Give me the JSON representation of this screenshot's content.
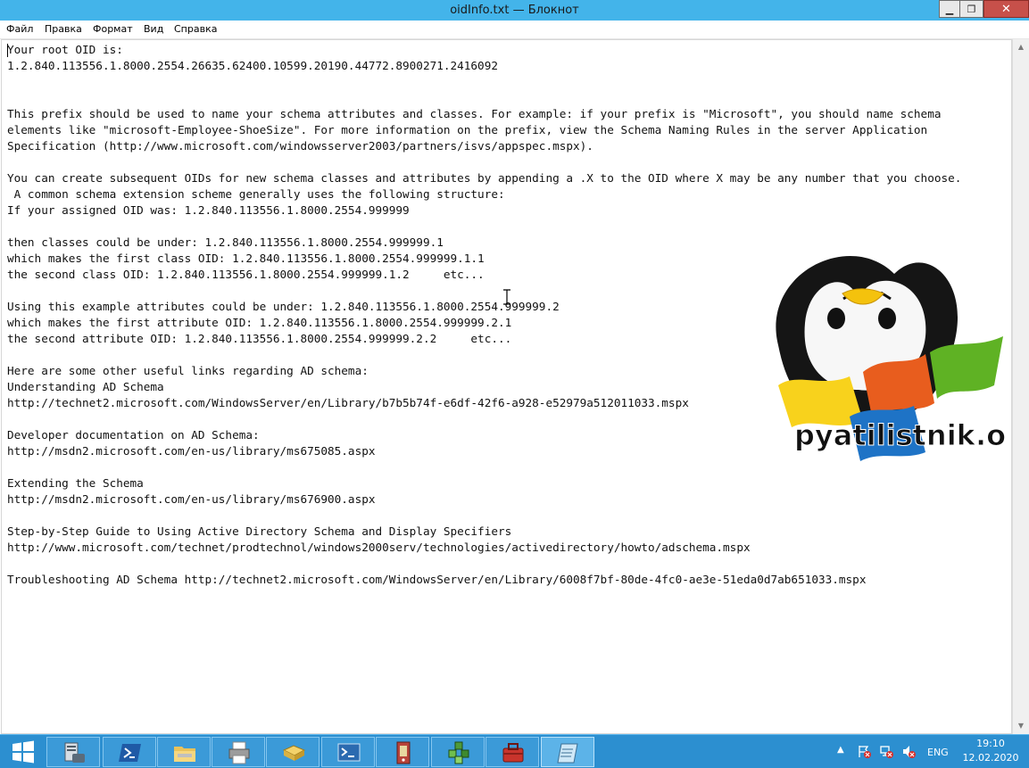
{
  "window": {
    "title": "oidInfo.txt — Блокнот",
    "minimize_glyph": "▁",
    "maximize_glyph": "❐",
    "close_glyph": "✕"
  },
  "menu": {
    "items": [
      "Файл",
      "Правка",
      "Формат",
      "Вид",
      "Справка"
    ]
  },
  "document": {
    "lines": [
      "Your root OID is:",
      "1.2.840.113556.1.8000.2554.26635.62400.10599.20190.44772.8900271.2416092",
      "",
      "",
      "This prefix should be used to name your schema attributes and classes. For example: if your prefix is \"Microsoft\", you should name schema",
      "elements like \"microsoft-Employee-ShoeSize\". For more information on the prefix, view the Schema Naming Rules in the server Application",
      "Specification (http://www.microsoft.com/windowsserver2003/partners/isvs/appspec.mspx).",
      "",
      "You can create subsequent OIDs for new schema classes and attributes by appending a .X to the OID where X may be any number that you choose.",
      " A common schema extension scheme generally uses the following structure:",
      "If your assigned OID was: 1.2.840.113556.1.8000.2554.999999",
      "",
      "then classes could be under: 1.2.840.113556.1.8000.2554.999999.1",
      "which makes the first class OID: 1.2.840.113556.1.8000.2554.999999.1.1",
      "the second class OID: 1.2.840.113556.1.8000.2554.999999.1.2     etc...",
      "",
      "Using this example attributes could be under: 1.2.840.113556.1.8000.2554.999999.2",
      "which makes the first attribute OID: 1.2.840.113556.1.8000.2554.999999.2.1",
      "the second attribute OID: 1.2.840.113556.1.8000.2554.999999.2.2     etc...",
      "",
      "Here are some other useful links regarding AD schema:",
      "Understanding AD Schema",
      "http://technet2.microsoft.com/WindowsServer/en/Library/b7b5b74f-e6df-42f6-a928-e52979a512011033.mspx",
      "",
      "Developer documentation on AD Schema:",
      "http://msdn2.microsoft.com/en-us/library/ms675085.aspx",
      "",
      "Extending the Schema",
      "http://msdn2.microsoft.com/en-us/library/ms676900.aspx",
      "",
      "Step-by-Step Guide to Using Active Directory Schema and Display Specifiers",
      "http://www.microsoft.com/technet/prodtechnol/windows2000serv/technologies/activedirectory/howto/adschema.mspx",
      "",
      "Troubleshooting AD Schema http://technet2.microsoft.com/WindowsServer/en/Library/6008f7bf-80de-4fc0-ae3e-51eda0d7ab651033.mspx"
    ]
  },
  "watermark": {
    "text": "pyatilistnik.org"
  },
  "scrollbar": {
    "up_glyph": "▲",
    "down_glyph": "▼"
  },
  "taskbar": {
    "apps": [
      {
        "name": "start",
        "icon": "windows-logo-icon"
      },
      {
        "name": "server-manager",
        "icon": "server-manager-icon"
      },
      {
        "name": "powershell",
        "icon": "powershell-icon"
      },
      {
        "name": "file-explorer",
        "icon": "folder-icon"
      },
      {
        "name": "printer",
        "icon": "printer-icon"
      },
      {
        "name": "file-cabinet",
        "icon": "drawer-icon"
      },
      {
        "name": "command-prompt",
        "icon": "terminal-icon"
      },
      {
        "name": "registry",
        "icon": "registry-icon"
      },
      {
        "name": "component-services",
        "icon": "cubes-icon"
      },
      {
        "name": "toolbox",
        "icon": "toolbox-icon"
      },
      {
        "name": "notepad",
        "icon": "notepad-icon"
      }
    ],
    "tray": {
      "chevron_glyph": "▲",
      "language": "ENG",
      "time": "19:10",
      "date": "12.02.2020"
    }
  },
  "colors": {
    "titlebar": "#43b4ea",
    "taskbar": "#2c8fd0",
    "close_button": "#c7504a"
  }
}
